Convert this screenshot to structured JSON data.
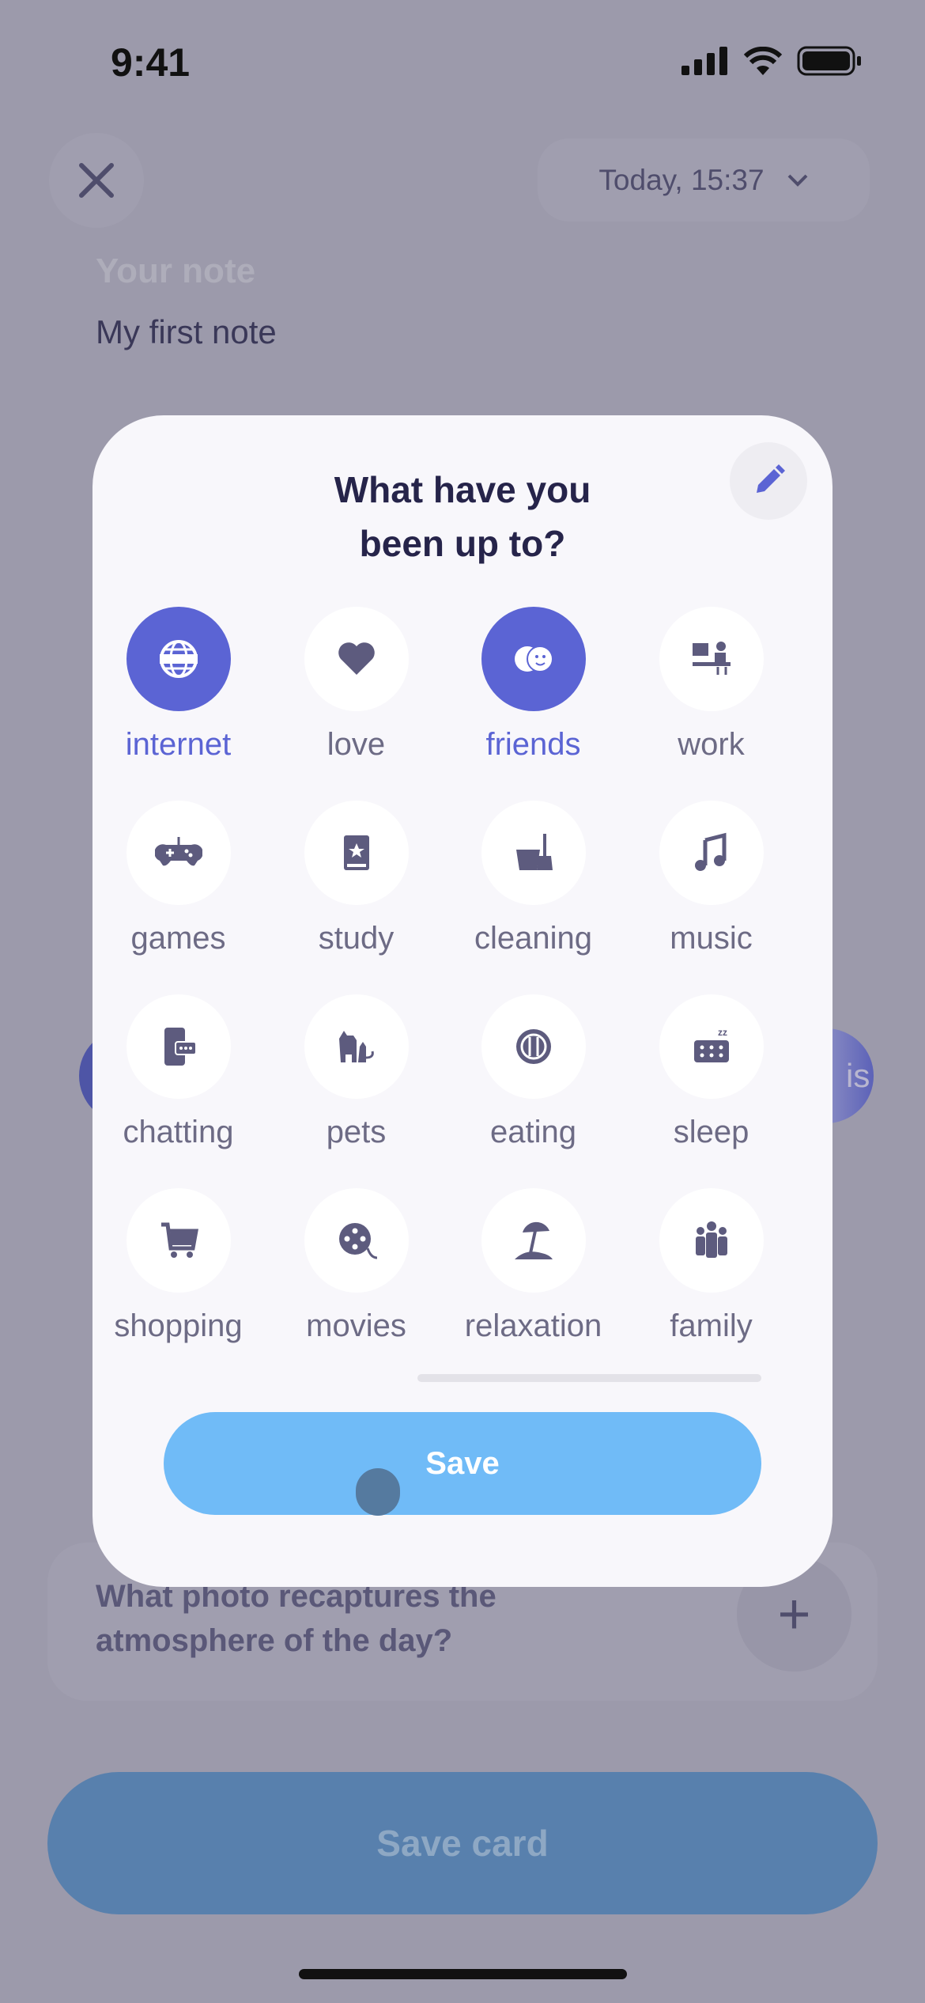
{
  "status_bar": {
    "time": "9:41"
  },
  "header": {
    "date": "Today, 15:37"
  },
  "note": {
    "label": "Your note",
    "value": "My first note"
  },
  "background": {
    "photo_question": [
      "What photo recaptures the",
      "atmosphere of the day?"
    ],
    "plus": "+",
    "partial_text": "is",
    "save_card": "Save card"
  },
  "modal": {
    "title": [
      "What have you",
      "been up to?"
    ],
    "activities": [
      {
        "label": "internet",
        "icon": "globe-www-icon",
        "selected": true
      },
      {
        "label": "love",
        "icon": "heart-icon",
        "selected": false
      },
      {
        "label": "friends",
        "icon": "friends-faces-icon",
        "selected": true
      },
      {
        "label": "work",
        "icon": "desk-worker-icon",
        "selected": false
      },
      {
        "label": "games",
        "icon": "gamepad-icon",
        "selected": false
      },
      {
        "label": "study",
        "icon": "book-icon",
        "selected": false
      },
      {
        "label": "cleaning",
        "icon": "bucket-broom-icon",
        "selected": false
      },
      {
        "label": "music",
        "icon": "music-note-icon",
        "selected": false
      },
      {
        "label": "chatting",
        "icon": "phone-chat-icon",
        "selected": false
      },
      {
        "label": "pets",
        "icon": "dog-cat-icon",
        "selected": false
      },
      {
        "label": "eating",
        "icon": "plate-fork-knife-icon",
        "selected": false
      },
      {
        "label": "sleep",
        "icon": "pillow-zzz-icon",
        "selected": false
      },
      {
        "label": "shopping",
        "icon": "cart-icon",
        "selected": false
      },
      {
        "label": "movies",
        "icon": "film-reel-icon",
        "selected": false
      },
      {
        "label": "relaxation",
        "icon": "beach-umbrella-icon",
        "selected": false
      },
      {
        "label": "family",
        "icon": "family-icon",
        "selected": false
      }
    ],
    "save": "Save"
  },
  "colors": {
    "accent": "#5b64d4",
    "save_button": "#70bbf7",
    "icon": "#5d5b7e",
    "overlay": "#9c9aab"
  }
}
